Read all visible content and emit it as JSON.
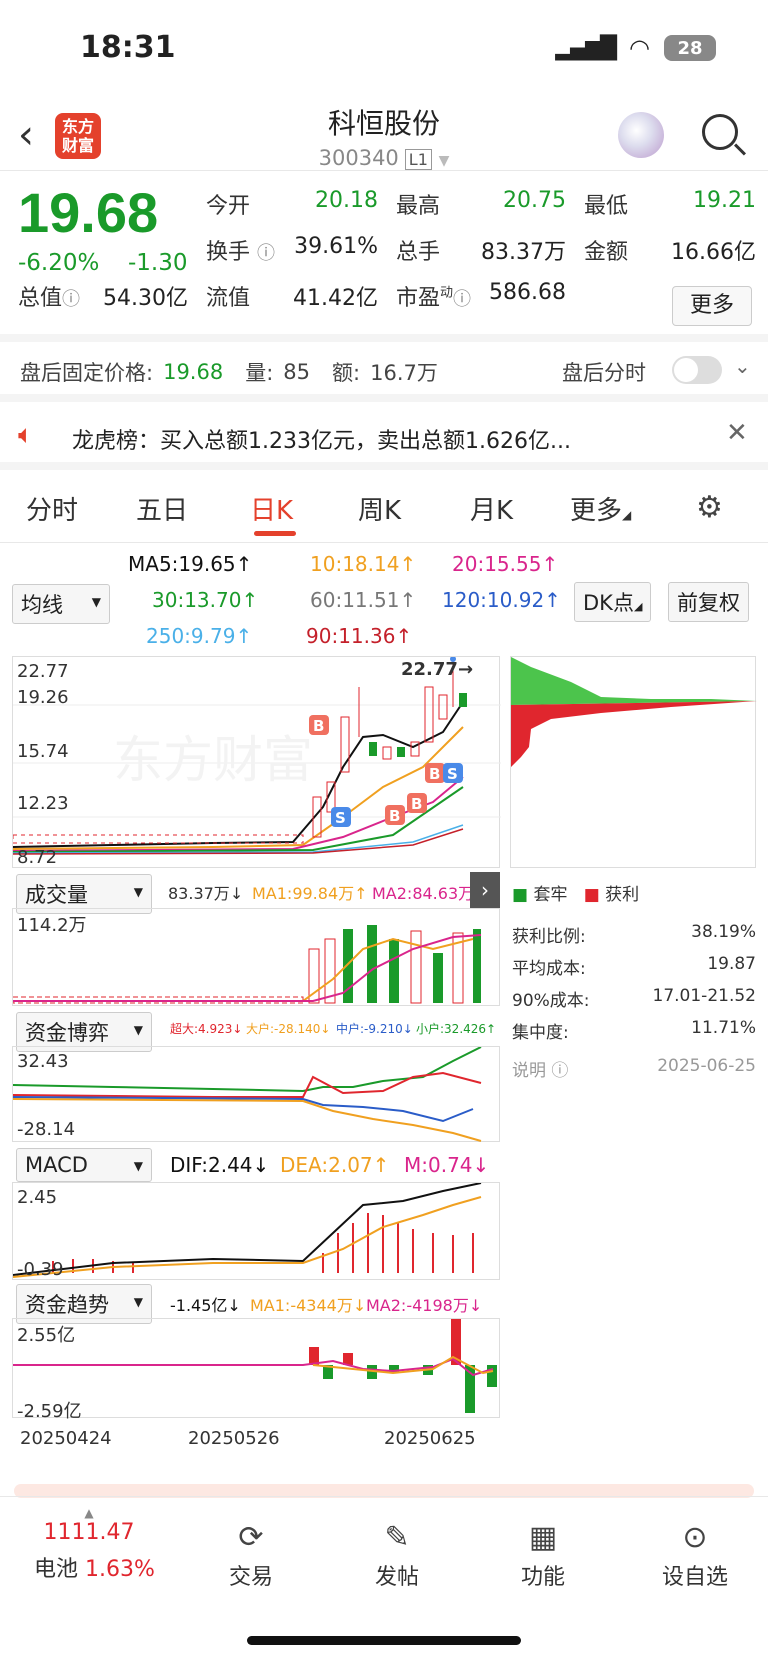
{
  "status": {
    "time": "18:31",
    "battery": "28"
  },
  "header": {
    "logo_line1": "东方",
    "logo_line2": "财富",
    "title": "科恒股份",
    "code": "300340",
    "level": "L1"
  },
  "quote": {
    "price": "19.68",
    "pct": "-6.20%",
    "change": "-1.30",
    "open_label": "今开",
    "open": "20.18",
    "high_label": "最高",
    "high": "20.75",
    "low_label": "最低",
    "low": "19.21",
    "turnover_label": "换手",
    "turnover": "39.61%",
    "volume_label": "总手",
    "volume": "83.37万",
    "amount_label": "金额",
    "amount": "16.66亿",
    "mktcap_label": "总值",
    "mktcap": "54.30亿",
    "float_label": "流值",
    "float": "41.42亿",
    "pe_label": "市盈",
    "pe_sup": "动",
    "pe": "586.68",
    "more": "更多"
  },
  "afterhours": {
    "label": "盘后固定价格:",
    "price": "19.68",
    "vol_label": "量:",
    "vol": "85",
    "amt_label": "额:",
    "amt": "16.7万",
    "toggle_label": "盘后分时"
  },
  "notice": {
    "text": "龙虎榜：买入总额1.233亿元，卖出总额1.626亿..."
  },
  "tabs": [
    "分时",
    "五日",
    "日K",
    "周K",
    "月K",
    "更多"
  ],
  "ma": {
    "select": "均线",
    "ma5": "MA5:19.65",
    "ma10": "10:18.14",
    "ma20": "20:15.55",
    "ma30": "30:13.70",
    "ma60": "60:11.51",
    "ma120": "120:10.92",
    "ma250": "250:9.79",
    "ma90": "90:11.36",
    "dk": "DK点",
    "fq": "前复权"
  },
  "kline": {
    "y_labels": [
      "22.77",
      "19.26",
      "15.74",
      "12.23",
      "8.72"
    ],
    "high_mark": "22.77"
  },
  "chip": {
    "legend_trap": "套牢",
    "legend_profit": "获利",
    "rows": [
      {
        "label": "获利比例:",
        "value": "38.19%"
      },
      {
        "label": "平均成本:",
        "value": "19.87"
      },
      {
        "label": "90%成本:",
        "value": "17.01-21.52"
      },
      {
        "label": "集中度:",
        "value": "11.71%"
      }
    ],
    "note_label": "说明",
    "date": "2025-06-25"
  },
  "volume": {
    "select": "成交量",
    "v": "83.37万",
    "ma1": "MA1:99.84万",
    "ma2": "MA2:84.63万",
    "top": "114.2万"
  },
  "fund": {
    "select": "资金博弈",
    "super": "超大:4.923",
    "big": "大户:-28.140",
    "mid": "中户:-9.210",
    "small": "小户:32.426",
    "top": "32.43",
    "bottom": "-28.14"
  },
  "macd": {
    "select": "MACD",
    "dif": "DIF:2.44",
    "dea": "DEA:2.07",
    "m": "M:0.74",
    "top": "2.45",
    "bottom": "-0.39"
  },
  "trend": {
    "select": "资金趋势",
    "v": "-1.45亿",
    "ma1": "MA1:-4344万",
    "ma2": "MA2:-4198万",
    "top": "2.55亿",
    "bottom": "-2.59亿"
  },
  "dates": [
    "20250424",
    "20250526",
    "20250625"
  ],
  "nav": {
    "index_value": "1111.47",
    "index_name": "电池",
    "index_pct": "1.63%",
    "trade": "交易",
    "post": "发帖",
    "func": "功能",
    "watch": "设自选"
  },
  "colors": {
    "up": "#e0262e",
    "down": "#1a9a2a",
    "accent": "#e4412c"
  }
}
